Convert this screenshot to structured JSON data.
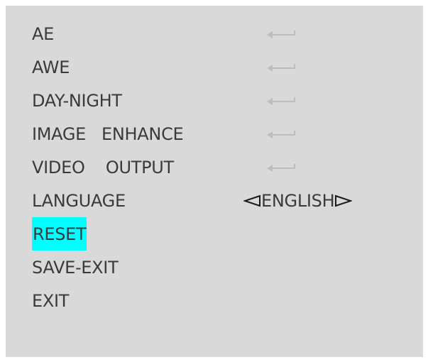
{
  "menu": {
    "items": [
      {
        "label": "AE",
        "has_submenu": true
      },
      {
        "label": "AWE",
        "has_submenu": true
      },
      {
        "label": "DAY-NIGHT",
        "has_submenu": true
      },
      {
        "label": "IMAGE   ENHANCE",
        "has_submenu": true
      },
      {
        "label": "VIDEO    OUTPUT",
        "has_submenu": true
      },
      {
        "label": "LANGUAGE",
        "value": "ENGLISH"
      },
      {
        "label": "RESET",
        "selected": true
      },
      {
        "label": "SAVE-EXIT"
      },
      {
        "label": "EXIT"
      }
    ]
  },
  "colors": {
    "background": "#d9d9d9",
    "text": "#3a3a3a",
    "highlight": "#00ffff",
    "enter_icon": "#bdbdbd"
  },
  "icons": {
    "submenu": "enter-return-arrow-icon",
    "language_prev": "triangle-left-icon",
    "language_next": "triangle-right-icon"
  }
}
